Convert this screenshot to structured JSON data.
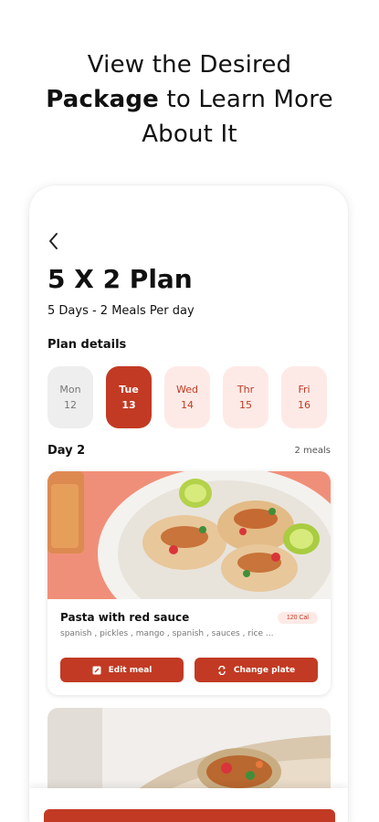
{
  "headline": {
    "line1": "View the Desired",
    "line2_bold": "Package",
    "line2_rest": " to Learn More",
    "line3": "About It"
  },
  "plan": {
    "title": "5 X 2 Plan",
    "subtitle": "5 Days - 2 Meals Per day",
    "details_label": "Plan details"
  },
  "days": [
    {
      "name": "Mon",
      "num": "12",
      "state": "past"
    },
    {
      "name": "Tue",
      "num": "13",
      "state": "active"
    },
    {
      "name": "Wed",
      "num": "14",
      "state": "future"
    },
    {
      "name": "Thr",
      "num": "15",
      "state": "future"
    },
    {
      "name": "Fri",
      "num": "16",
      "state": "future"
    }
  ],
  "selected_day": {
    "label": "Day 2",
    "meal_count": "2 meals"
  },
  "meal": {
    "name": "Pasta with red sauce",
    "calories": "120 Cal",
    "ingredients": "spanish , pickles , mango , spanish , sauces , rice ...",
    "edit_label": "Edit meal",
    "change_label": "Change plate"
  },
  "icons": {
    "back": "chevron-left-icon",
    "edit": "edit-icon",
    "change": "swap-icon"
  },
  "colors": {
    "accent": "#c23a23",
    "accent_light": "#fdeae6",
    "past_bg": "#eeeeee"
  }
}
